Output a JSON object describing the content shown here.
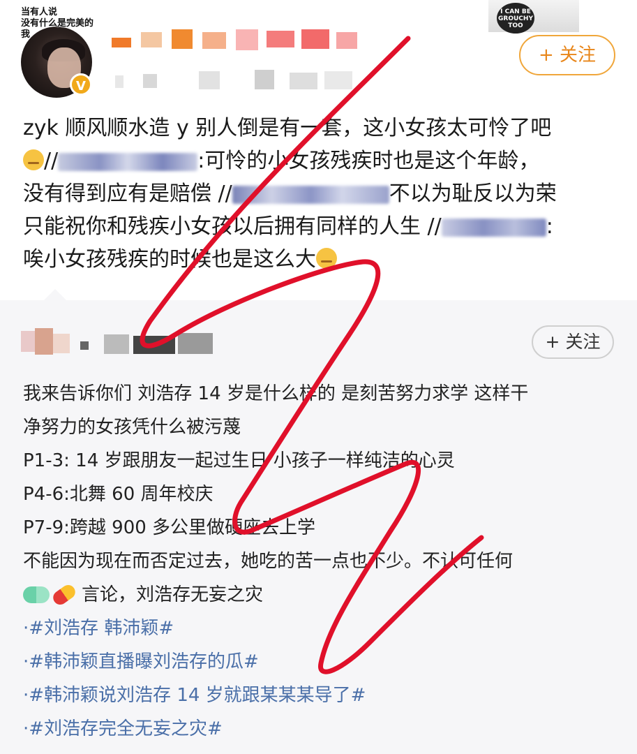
{
  "author": {
    "avatar_caption_line1": "当有人说",
    "avatar_caption_line2": "没有什么是完美的",
    "avatar_caption_line3": "我",
    "follow_label": "+ 关注",
    "sticker_text": "I CAN BE GROUCHY TOO"
  },
  "post": {
    "line1": "zyk 顺风顺水造 y 别人倒是有一套，这小女孩太可怜了吧",
    "line2_prefix": "//",
    "line2_suffix": ":可怜的小女孩残疾时也是这个年龄，",
    "line3_prefix": "没有得到应有是赔偿 //",
    "line3_suffix": "不以为耻反以为荣",
    "line4_prefix": "只能祝你和残疾小女孩以后拥有同样的人生 //",
    "line4_suffix": ":",
    "line5": "唉小女孩残疾的时候也是这么大"
  },
  "repost": {
    "follow_label": "+ 关注",
    "line1": "我来告诉你们 刘浩存 14 岁是什么样的 是刻苦努力求学 这样干",
    "line2": "净努力的女孩凭什么被污蔑",
    "line3": "P1-3: 14 岁跟朋友一起过生日 小孩子一样纯洁的心灵",
    "line4": "P4-6:北舞 60 周年校庆",
    "line5": "P7-9:跨越 900 多公里做硬座去上学",
    "line6": "不能因为现在而否定过去，她吃的苦一点也不少。不认可任何",
    "line7": "言论，刘浩存无妄之灾",
    "topics": [
      "·#刘浩存 韩沛颖#",
      "·#韩沛颖直播曝刘浩存的瓜#",
      "·#韩沛颖说刘浩存 14 岁就跟某某某导了#",
      "·#刘浩存完全无妄之灾#"
    ]
  },
  "colors": {
    "follow_accent": "#e8861a",
    "topic_link": "#4a6fa8",
    "scribble": "#e0102a"
  },
  "icons": [
    "verified-v-icon",
    "unamused-emoji-icon",
    "dizzy-emoji-icon",
    "pill-icon",
    "capsule-icon"
  ]
}
